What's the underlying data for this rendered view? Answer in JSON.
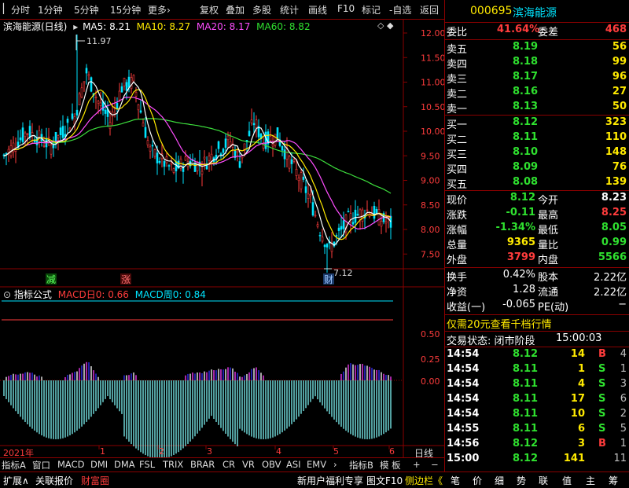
{
  "toolbar": {
    "left_items": [
      "分时",
      "1分钟",
      "5分钟",
      "15分钟",
      "更多›"
    ],
    "right_items": [
      "复权",
      "叠加",
      "多股",
      "统计",
      "画线",
      "F10",
      "标记",
      "-自选",
      "返回"
    ]
  },
  "stock": {
    "code": "000695",
    "name": "滨海能源"
  },
  "price_chart": {
    "title": "滨海能源(日线)",
    "ma_labels": [
      {
        "text": "MA5: 8.21",
        "color": "#ffffff"
      },
      {
        "text": "MA10: 8.27",
        "color": "#ffea00"
      },
      {
        "text": "MA20: 8.17",
        "color": "#ff4dff"
      },
      {
        "text": "MA60: 8.82",
        "color": "#3cdc3c"
      }
    ],
    "high_mark": "11.97",
    "low_mark": "7.12",
    "y_ticks": [
      "12.00",
      "11.50",
      "11.00",
      "10.50",
      "10.00",
      "9.50",
      "9.00",
      "8.50",
      "8.00",
      "7.50"
    ],
    "marker_left": "减",
    "marker_mid": "涨",
    "marker_low": "财"
  },
  "macd_panel": {
    "title": "指标公式",
    "macd_day": "MACD日0: 0.66",
    "macd_week": "MACD周0: 0.84",
    "y_ticks": [
      "0.50",
      "0.25",
      "0.00"
    ]
  },
  "chart_data": {
    "type": "candlestick",
    "title": "滨海能源(日线)",
    "ylim": [
      7.0,
      12.2
    ],
    "x_tick_labels": [
      "2021年",
      "1",
      "2",
      "3",
      "4",
      "5",
      "6"
    ],
    "series": [
      {
        "name": "MA5",
        "last": 8.21
      },
      {
        "name": "MA10",
        "last": 8.27
      },
      {
        "name": "MA20",
        "last": 8.17
      },
      {
        "name": "MA60",
        "last": 8.82
      }
    ]
  },
  "xaxis": {
    "labels": [
      "2021年",
      "1",
      "2",
      "3",
      "4",
      "5",
      "6"
    ],
    "right_label": "日线"
  },
  "bottom_tabs": [
    "指标A",
    "窗口",
    "MACD",
    "DMI",
    "DMA",
    "FSL",
    "TRIX",
    "BRAR",
    "CR",
    "VR",
    "OBV",
    "ASI",
    "EMV",
    "›",
    "指标B",
    "模 板",
    "+",
    "−"
  ],
  "order_book": {
    "weibi_label": "委比",
    "weibi_value": "41.64%",
    "weicha_label": "委差",
    "weicha_value": "468",
    "sells": [
      {
        "label": "卖五",
        "price": "8.19",
        "vol": "56"
      },
      {
        "label": "卖四",
        "price": "8.18",
        "vol": "99"
      },
      {
        "label": "卖三",
        "price": "8.17",
        "vol": "96"
      },
      {
        "label": "卖二",
        "price": "8.16",
        "vol": "27"
      },
      {
        "label": "卖一",
        "price": "8.13",
        "vol": "50"
      }
    ],
    "buys": [
      {
        "label": "买一",
        "price": "8.12",
        "vol": "323"
      },
      {
        "label": "买二",
        "price": "8.11",
        "vol": "110"
      },
      {
        "label": "买三",
        "price": "8.10",
        "vol": "148"
      },
      {
        "label": "买四",
        "price": "8.09",
        "vol": "76"
      },
      {
        "label": "买五",
        "price": "8.08",
        "vol": "139"
      }
    ]
  },
  "quote": [
    {
      "l1": "现价",
      "v1": "8.12",
      "c1": "green",
      "l2": "今开",
      "v2": "8.23",
      "c2": "white"
    },
    {
      "l1": "涨跌",
      "v1": "-0.11",
      "c1": "green",
      "l2": "最高",
      "v2": "8.25",
      "c2": "red"
    },
    {
      "l1": "涨幅",
      "v1": "-1.34%",
      "c1": "green",
      "l2": "最低",
      "v2": "8.05",
      "c2": "green"
    },
    {
      "l1": "总量",
      "v1": "9365",
      "c1": "yellow",
      "l2": "量比",
      "v2": "0.99",
      "c2": "green"
    },
    {
      "l1": "外盘",
      "v1": "3799",
      "c1": "red",
      "l2": "内盘",
      "v2": "5566",
      "c2": "green"
    }
  ],
  "fundamentals": [
    {
      "l1": "换手",
      "v1": "0.42%",
      "l2": "股本",
      "v2": "2.22亿"
    },
    {
      "l1": "净资",
      "v1": "1.28",
      "l2": "流通",
      "v2": "2.22亿"
    },
    {
      "l1": "收益(一)",
      "v1": "-0.065",
      "l2": "PE(动)",
      "v2": "−"
    }
  ],
  "promo": "仅需20元查看千档行情",
  "trade_status": {
    "label": "交易状态: 闭市阶段",
    "time": "15:00:03"
  },
  "ticks": [
    {
      "t": "14:54",
      "p": "8.12",
      "v": "14",
      "d": "B",
      "n": "4"
    },
    {
      "t": "14:54",
      "p": "8.11",
      "v": "1",
      "d": "S",
      "n": "1"
    },
    {
      "t": "14:54",
      "p": "8.11",
      "v": "4",
      "d": "S",
      "n": "3"
    },
    {
      "t": "14:54",
      "p": "8.11",
      "v": "17",
      "d": "S",
      "n": "6"
    },
    {
      "t": "14:54",
      "p": "8.11",
      "v": "10",
      "d": "S",
      "n": "2"
    },
    {
      "t": "14:55",
      "p": "8.11",
      "v": "6",
      "d": "S",
      "n": "5"
    },
    {
      "t": "14:56",
      "p": "8.12",
      "v": "3",
      "d": "B",
      "n": "1"
    },
    {
      "t": "15:00",
      "p": "8.12",
      "v": "141",
      "d": "",
      "n": "11"
    }
  ],
  "statusbar": {
    "left": [
      "扩展∧",
      "关联报价",
      "财富圈"
    ],
    "mid": [
      "新用户福利专享",
      "图文F10",
      "侧边栏《"
    ],
    "right": [
      "笔",
      "价",
      "细",
      "势",
      "联",
      "值",
      "主",
      "筹"
    ]
  }
}
